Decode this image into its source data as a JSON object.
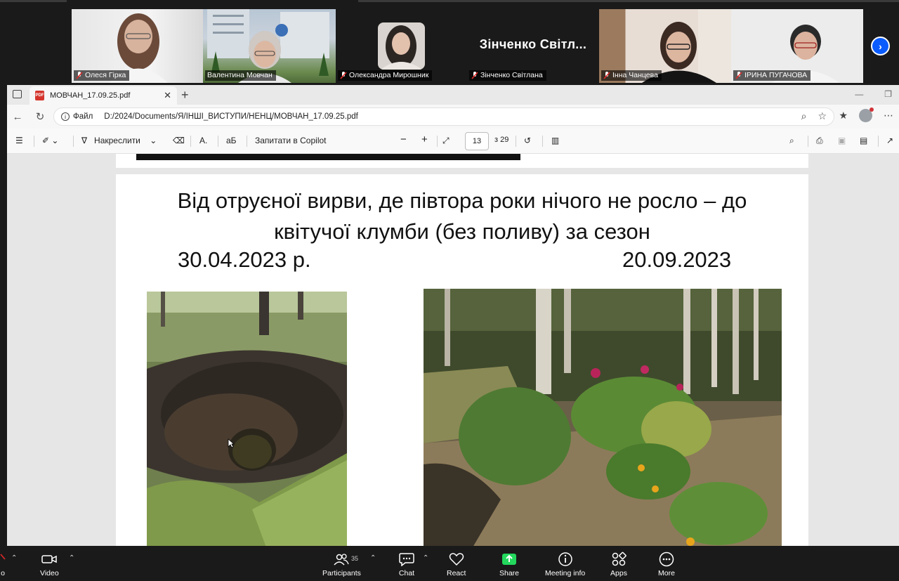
{
  "gallery": {
    "participants": [
      {
        "name": "Олеся Гірка",
        "muted": true
      },
      {
        "name": "Валентина Мовчан",
        "muted": false,
        "active": true
      },
      {
        "name": "Олександра Мирошник",
        "muted": true
      },
      {
        "name": "Зінченко Світлана",
        "muted": true,
        "display_name": "Зінченко  Світл..."
      },
      {
        "name": "Інна Чанцева",
        "muted": true
      },
      {
        "name": "ІРИНА ПУГАЧОВА",
        "muted": true
      }
    ]
  },
  "browser": {
    "tab_title": "МОВЧАН_17.09.25.pdf",
    "address_label": "Файл",
    "address_path": "D:/2024/Documents/Я/ІНШІ_ВИСТУПИ/НЕНЦ/МОВЧАН_17.09.25.pdf"
  },
  "pdf_toolbar": {
    "draw_label": "Накреслити",
    "copilot_label": "Запитати в Copilot",
    "page_current": "13",
    "page_total": "з 29"
  },
  "slide": {
    "title_line1": "Від отруєної вирви, де півтора роки нічого не росло – до",
    "title_line2": "квітучої клумби (без поливу) за сезон",
    "date_before": "30.04.2023 р.",
    "date_after": "20.09.2023"
  },
  "zoom_bar": {
    "audio_label": "o",
    "video_label": "Video",
    "participants_label": "Participants",
    "participants_count": "35",
    "chat_label": "Chat",
    "react_label": "React",
    "share_label": "Share",
    "meeting_info_label": "Meeting info",
    "apps_label": "Apps",
    "more_label": "More",
    "share_color": "#23d85d"
  }
}
